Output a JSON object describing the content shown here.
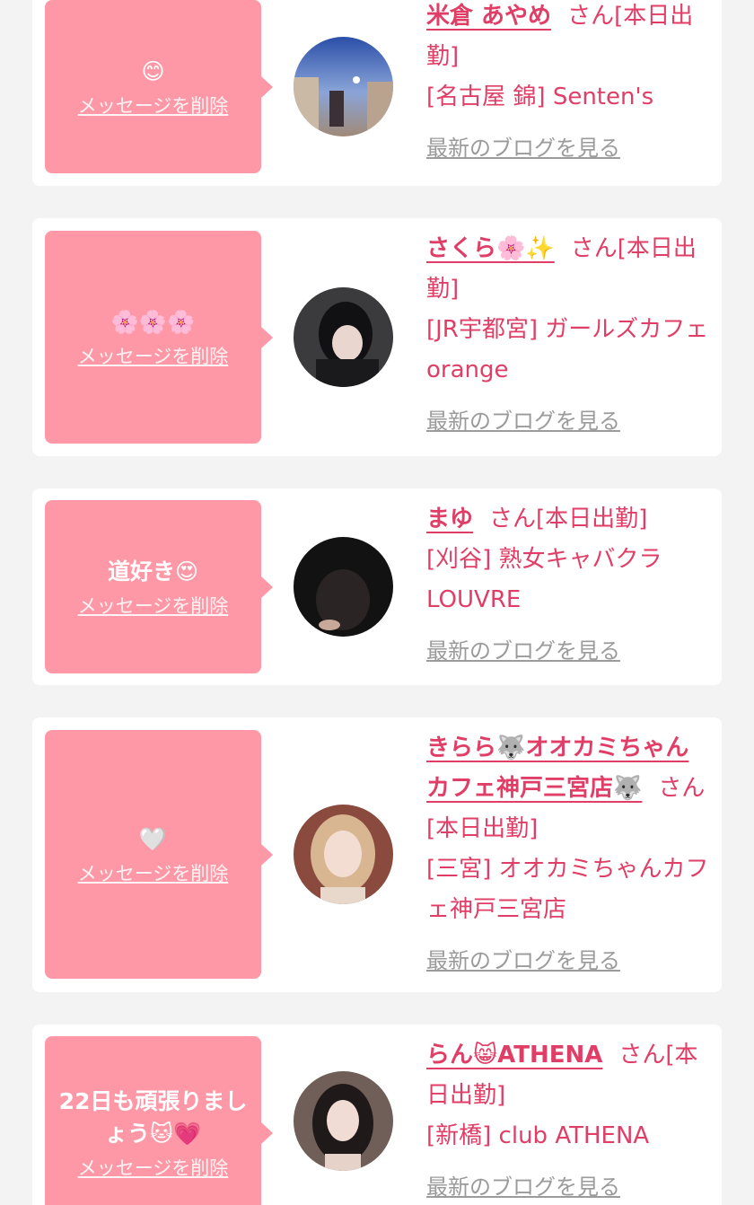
{
  "cards": [
    {
      "message": "😊",
      "delete_label": "メッセージを削除",
      "name": "米倉 あやめ",
      "status": "さん[本日出勤]",
      "shop": "[名古屋 錦] Senten's",
      "blog_label": "最新のブログを見る"
    },
    {
      "message": "🌸🌸🌸",
      "delete_label": "メッセージを削除",
      "name": "さくら🌸✨",
      "status": "さん[本日出勤]",
      "shop": "[JR宇都宮] ガールズカフェ orange",
      "blog_label": "最新のブログを見る"
    },
    {
      "message": "道好き😍",
      "delete_label": "メッセージを削除",
      "name": "まゆ",
      "status": "さん[本日出勤]",
      "shop": "[刈谷] 熟女キャバクラ LOUVRE",
      "blog_label": "最新のブログを見る"
    },
    {
      "message": "🤍",
      "delete_label": "メッセージを削除",
      "name": "きらら🐺オオカミちゃんカフェ神戸三宮店🐺",
      "status": "さん[本日出勤]",
      "shop": "[三宮] オオカミちゃんカフェ神戸三宮店",
      "blog_label": "最新のブログを見る"
    },
    {
      "message": "22日も頑張りましょう🐱💗",
      "delete_label": "メッセージを削除",
      "name": "らん😸ATHENA",
      "status": "さん[本日出勤]",
      "shop": "[新橋] club ATHENA",
      "blog_label": "最新のブログを見る"
    }
  ]
}
